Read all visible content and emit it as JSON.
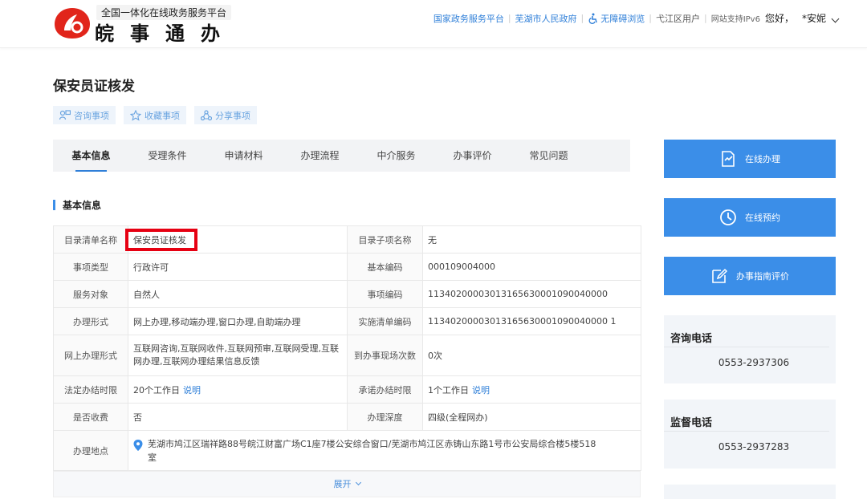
{
  "header": {
    "platform_tag": "全国一体化在线政务服务平台",
    "brand_name": "皖事通办",
    "nav": {
      "national_platform": "国家政务服务平台",
      "city_gov": "芜湖市人民政府",
      "accessible": "无障碍浏览",
      "district_user": "弋江区用户",
      "ipv6": "网站支持IPv6",
      "greeting": "您好，",
      "username": "*安妮"
    }
  },
  "page_title": "保安员证核发",
  "actions": {
    "consult": "咨询事项",
    "favorite": "收藏事项",
    "share": "分享事项"
  },
  "tabs": [
    "基本信息",
    "受理条件",
    "申请材料",
    "办理流程",
    "中介服务",
    "办事评价",
    "常见问题"
  ],
  "section_title": "基本信息",
  "info": {
    "catalog_name_label": "目录清单名称",
    "catalog_name": "保安员证核发",
    "sub_item_label": "目录子项名称",
    "sub_item": "无",
    "type_label": "事项类型",
    "type": "行政许可",
    "basic_code_label": "基本编码",
    "basic_code": "000109004000",
    "target_label": "服务对象",
    "target": "自然人",
    "item_code_label": "事项编码",
    "item_code": "11340200003013165630001090040000",
    "form_label": "办理形式",
    "form": "网上办理,移动端办理,窗口办理,自助端办理",
    "impl_code_label": "实施清单编码",
    "impl_code": "11340200003013165630001090040000 1",
    "online_form_label": "网上办理形式",
    "online_form": "互联网咨询,互联网收件,互联网预审,互联网受理,互联网办理,互联网办理结果信息反馈",
    "visits_label": "到办事现场次数",
    "visits": "0次",
    "legal_limit_label": "法定办结时限",
    "legal_limit": "20个工作日",
    "promise_limit_label": "承诺办结时限",
    "promise_limit": "1个工作日",
    "explain": "说明",
    "fee_label": "是否收费",
    "fee": "否",
    "depth_label": "办理深度",
    "depth": "四级(全程网办)",
    "location_label": "办理地点",
    "location": "芜湖市鸠江区瑞祥路88号皖江财富广场C1座7楼公安综合窗口/芜湖市鸠江区赤铸山东路1号市公安局综合楼5楼518室"
  },
  "expand": "展开",
  "side": {
    "online_handle": "在线办理",
    "online_booking": "在线预约",
    "guide_rating": "办事指南评价",
    "consult_phone_title": "咨询电话",
    "consult_phone": "0553-2937306",
    "supervise_phone_title": "监督电话",
    "supervise_phone": "0553-2937283"
  },
  "colors": {
    "accent": "#3b8ee8",
    "highlight_box": "#e60012",
    "logo_red": "#e1251b"
  }
}
